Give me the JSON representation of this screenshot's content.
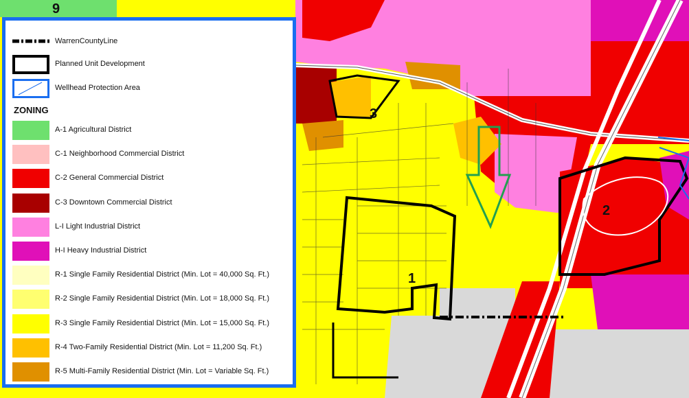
{
  "map": {
    "area_labels": [
      "9",
      "3",
      "2",
      "1"
    ]
  },
  "legend": {
    "lines": [
      {
        "label": "WarrenCountyLine",
        "symbol": "dash-dot-line"
      },
      {
        "label": "Planned Unit Development",
        "symbol": "thick-black-box"
      },
      {
        "label": "Wellhead Protection Area",
        "symbol": "blue-box-diagonal"
      }
    ],
    "zoning_heading": "ZONING",
    "zones": [
      {
        "label": "A-1 Agricultural District",
        "color": "#6ee06e"
      },
      {
        "label": "C-1 Neighborhood Commercial District",
        "color": "#ffc0c0"
      },
      {
        "label": "C-2 General Commercial District",
        "color": "#f00000"
      },
      {
        "label": "C-3 Downtown Commercial District",
        "color": "#a80000"
      },
      {
        "label": "L-I Light Industrial District",
        "color": "#ff80e0"
      },
      {
        "label": "H-I Heavy Industrial District",
        "color": "#e010b8"
      },
      {
        "label": "R-1 Single Family Residential District  (Min. Lot = 40,000 Sq. Ft.)",
        "color": "#ffffc0"
      },
      {
        "label": "R-2 Single Family Residential District  (Min. Lot = 18,000 Sq. Ft.)",
        "color": "#ffff70"
      },
      {
        "label": "R-3 Single Family Residential District  (Min. Lot = 15,000 Sq. Ft.)",
        "color": "#ffff00"
      },
      {
        "label": "R-4 Two-Family Residential District  (Min. Lot = 11,200 Sq. Ft.)",
        "color": "#ffc000"
      },
      {
        "label": "R-5 Multi-Family Residential District  (Min. Lot = Variable Sq. Ft.)",
        "color": "#e09000"
      }
    ]
  },
  "colors": {
    "legend_border": "#1a6ef0",
    "arrow": "#22a050",
    "road": "#d9d9d9"
  }
}
